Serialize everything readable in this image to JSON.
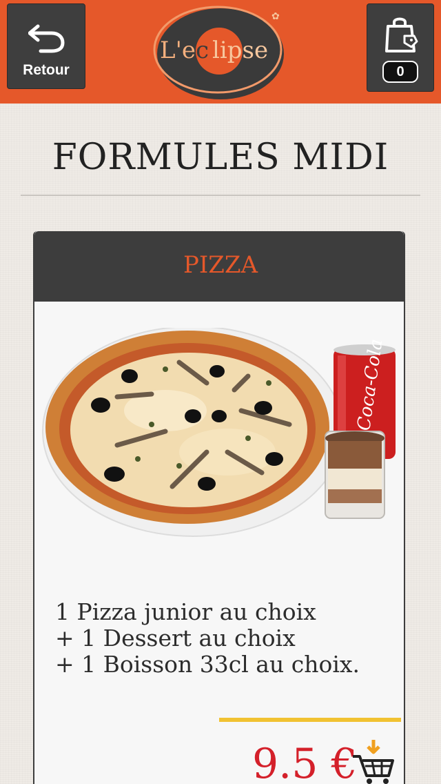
{
  "header": {
    "back_label": "Retour",
    "cart_count": "0",
    "logo_text": "L'eclipse",
    "accent_color": "#e5582a",
    "button_bg": "#3e3e3e"
  },
  "page": {
    "title": "FORMULES MIDI"
  },
  "card": {
    "title": "PIZZA",
    "description_lines": [
      "1 Pizza junior au choix",
      "+ 1 Dessert au choix",
      "+ 1 Boisson 33cl au choix."
    ],
    "price": "9.5 €",
    "price_color": "#d4202a"
  },
  "icons": {
    "back": "back-arrow-icon",
    "cart": "shopping-bag-icon",
    "add_to_cart": "add-to-cart-icon"
  }
}
